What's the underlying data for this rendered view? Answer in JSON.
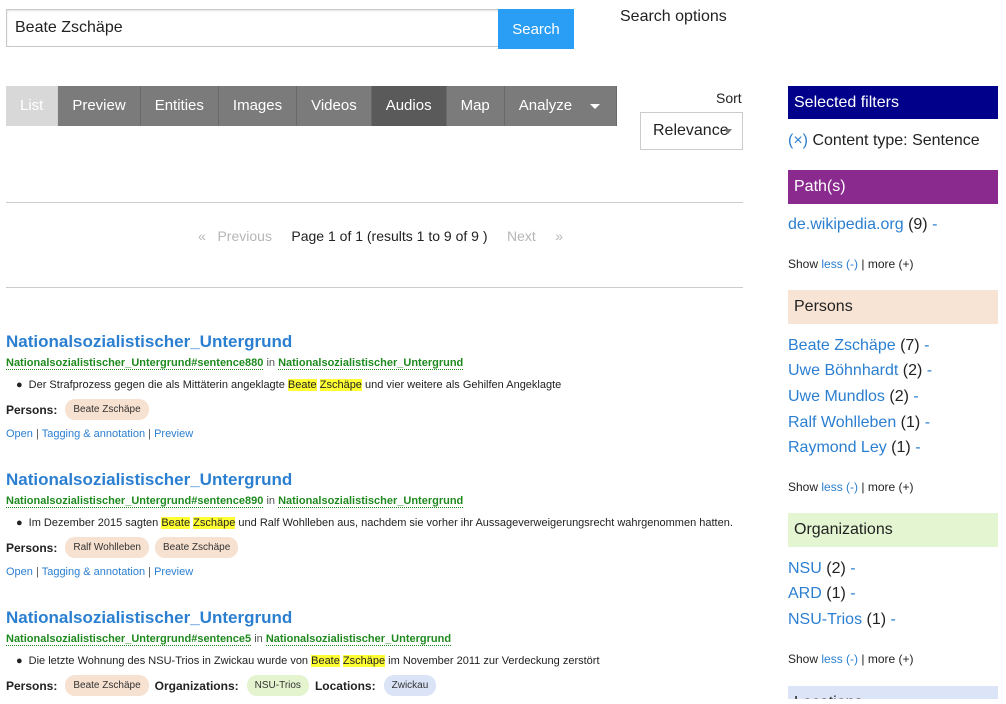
{
  "search": {
    "value": "Beate Zschäpe",
    "button": "Search",
    "options_label": "Search options"
  },
  "tabs": [
    "List",
    "Preview",
    "Entities",
    "Images",
    "Videos",
    "Audios",
    "Map",
    "Analyze"
  ],
  "sort": {
    "label": "Sort",
    "value": "Relevance"
  },
  "pager": {
    "prev_arrow": "«",
    "prev": "Previous",
    "summary": "Page 1 of 1 (results 1 to 9 of 9 )",
    "next": "Next",
    "next_arrow": "»"
  },
  "results": [
    {
      "title": "Nationalsozialistischer_Untergrund",
      "anchor": "Nationalsozialistischer_Untergrund#sentence880",
      "in": "in",
      "parent": "Nationalsozialistischer_Untergrund",
      "snippet_before": "Der Strafprozess gegen die als Mittäterin angeklagte ",
      "hl1": "Beate",
      "hl2": "Zschäpe",
      "snippet_after": " und vier weitere als Gehilfen Angeklagte",
      "persons_label": "Persons:",
      "persons": [
        "Beate Zschäpe"
      ]
    },
    {
      "title": "Nationalsozialistischer_Untergrund",
      "anchor": "Nationalsozialistischer_Untergrund#sentence890",
      "in": "in",
      "parent": "Nationalsozialistischer_Untergrund",
      "snippet_before": "Im Dezember 2015 sagten ",
      "hl1": "Beate",
      "hl2": "Zschäpe",
      "snippet_after": " und Ralf Wohlleben aus, nachdem sie vorher ihr Aussageverweigerungsrecht wahrgenommen hatten.",
      "persons_label": "Persons:",
      "persons": [
        "Ralf Wohlleben",
        "Beate Zschäpe"
      ]
    },
    {
      "title": "Nationalsozialistischer_Untergrund",
      "anchor": "Nationalsozialistischer_Untergrund#sentence5",
      "in": "in",
      "parent": "Nationalsozialistischer_Untergrund",
      "snippet_before": "Die letzte Wohnung des NSU-Trios in Zwickau wurde von ",
      "hl1": "Beate",
      "hl2": "Zschäpe",
      "snippet_after": " im November 2011 zur Verdeckung zerstört",
      "persons_label": "Persons:",
      "persons": [
        "Beate Zschäpe"
      ],
      "orgs_label": "Organizations:",
      "orgs": [
        "NSU-Trios"
      ],
      "locs_label": "Locations:",
      "locs": [
        "Zwickau"
      ]
    }
  ],
  "actions": {
    "open": "Open",
    "tagging": "Tagging & annotation",
    "preview": "Preview",
    "sep": "|"
  },
  "sidebar": {
    "selected": {
      "title": "Selected filters",
      "remove": "(×)",
      "filter": "Content type: Sentence"
    },
    "paths": {
      "title": "Path(s)",
      "items": [
        {
          "label": "de.wikipedia.org",
          "count": "(9)"
        }
      ]
    },
    "persons": {
      "title": "Persons",
      "items": [
        {
          "label": "Beate Zschäpe",
          "count": "(7)"
        },
        {
          "label": "Uwe Böhnhardt",
          "count": "(2)"
        },
        {
          "label": "Uwe Mundlos",
          "count": "(2)"
        },
        {
          "label": "Ralf Wohlleben",
          "count": "(1)"
        },
        {
          "label": "Raymond Ley",
          "count": "(1)"
        }
      ]
    },
    "orgs": {
      "title": "Organizations",
      "items": [
        {
          "label": "NSU",
          "count": "(2)"
        },
        {
          "label": "ARD",
          "count": "(1)"
        },
        {
          "label": "NSU-Trios",
          "count": "(1)"
        }
      ]
    },
    "locations": {
      "title": "Locations"
    },
    "show": {
      "show": "Show",
      "less": "less (-)",
      "sep": "|",
      "more": "more (+)"
    },
    "minus": "-"
  },
  "colors": {
    "selected_head": "#00008b",
    "paths_head": "#8b2a8e",
    "persons_head": "#f8e4d4",
    "orgs_head": "#e4f5d2",
    "locations_head": "#dce4f7",
    "accent": "#2a9df4"
  }
}
